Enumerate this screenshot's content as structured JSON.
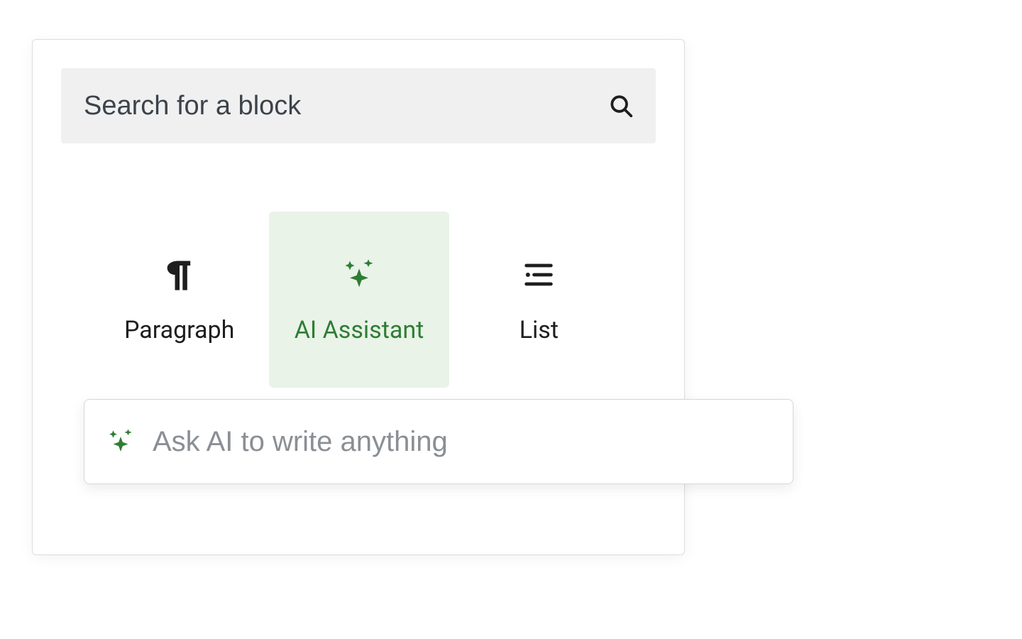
{
  "search": {
    "placeholder": "Search for a block"
  },
  "blocks": {
    "items": [
      {
        "label": "Paragraph"
      },
      {
        "label": "AI Assistant"
      },
      {
        "label": "List"
      }
    ],
    "selected_index": 1
  },
  "ai_prompt": {
    "placeholder": "Ask AI to write anything"
  },
  "colors": {
    "accent_green": "#2e7d32",
    "selected_bg": "#e9f3e8"
  }
}
